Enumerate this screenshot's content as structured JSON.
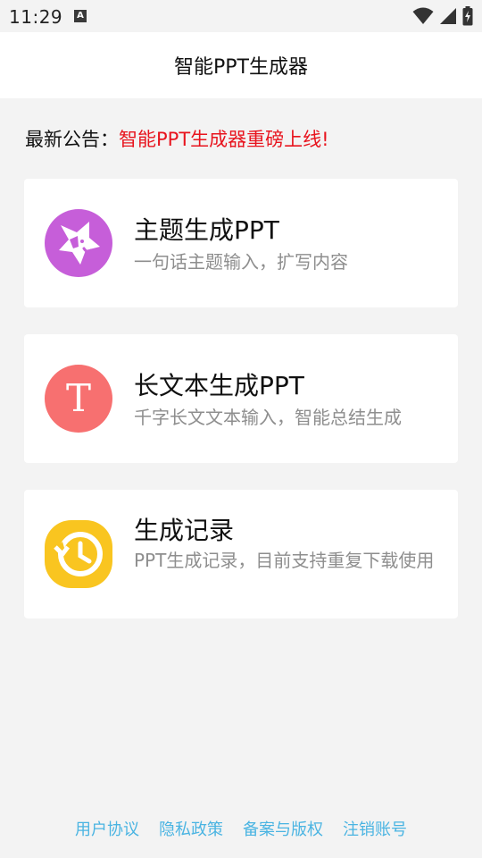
{
  "status_bar": {
    "time": "11:29",
    "notification_icon_label": "A",
    "icons": [
      "wifi-icon",
      "signal-icon",
      "battery-charging-icon"
    ]
  },
  "header": {
    "title": "智能PPT生成器"
  },
  "notice": {
    "label": "最新公告：",
    "text": "智能PPT生成器重磅上线!"
  },
  "cards": [
    {
      "title": "主题生成PPT",
      "desc": "一句话主题输入，扩写内容",
      "icon": "star-sticker-icon",
      "icon_color": "#c65ed9"
    },
    {
      "title": "长文本生成PPT",
      "desc": "千字长文文本输入，智能总结生成",
      "icon": "text-t-icon",
      "icon_letter": "T",
      "icon_color": "#f77070"
    },
    {
      "title": "生成记录",
      "desc": "PPT生成记录，目前支持重复下载使用",
      "icon": "clock-history-icon",
      "icon_color": "#f9c520"
    }
  ],
  "footer": {
    "links": [
      "用户协议",
      "隐私政策",
      "备案与版权",
      "注销账号"
    ],
    "link_color": "#4ab4e2"
  }
}
